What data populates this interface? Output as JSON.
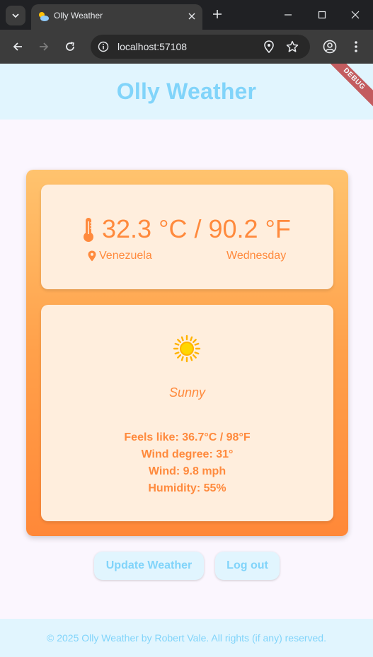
{
  "browser": {
    "tab_title": "Olly Weather",
    "url": "localhost:57108"
  },
  "app": {
    "title": "Olly Weather",
    "debug_banner": "DEBUG",
    "temperature": "32.3 °C / 90.2 °F",
    "location": "Venezuela",
    "day": "Wednesday",
    "condition": "Sunny",
    "details": {
      "feels_like": "Feels like: 36.7°C / 98°F",
      "wind_degree": "Wind degree: 31°",
      "wind": "Wind: 9.8 mph",
      "humidity": "Humidity: 55%"
    },
    "buttons": {
      "update": "Update Weather",
      "logout": "Log out"
    },
    "footer": "© 2025 Olly Weather by Robert Vale. All rights (if any) reserved."
  },
  "colors": {
    "header_bg": "#e1f5fe",
    "accent_blue": "#81d4fa",
    "accent_orange": "#ff8a3d",
    "panel_bg": "#ffeedd"
  },
  "icons": [
    "tab-search-icon",
    "weather-favicon-icon",
    "close-icon",
    "plus-icon",
    "minimize-icon",
    "maximize-icon",
    "back-icon",
    "forward-icon",
    "reload-icon",
    "info-icon",
    "location-icon",
    "star-icon",
    "profile-icon",
    "menu-icon",
    "thermometer-icon",
    "pin-icon",
    "sun-icon"
  ]
}
